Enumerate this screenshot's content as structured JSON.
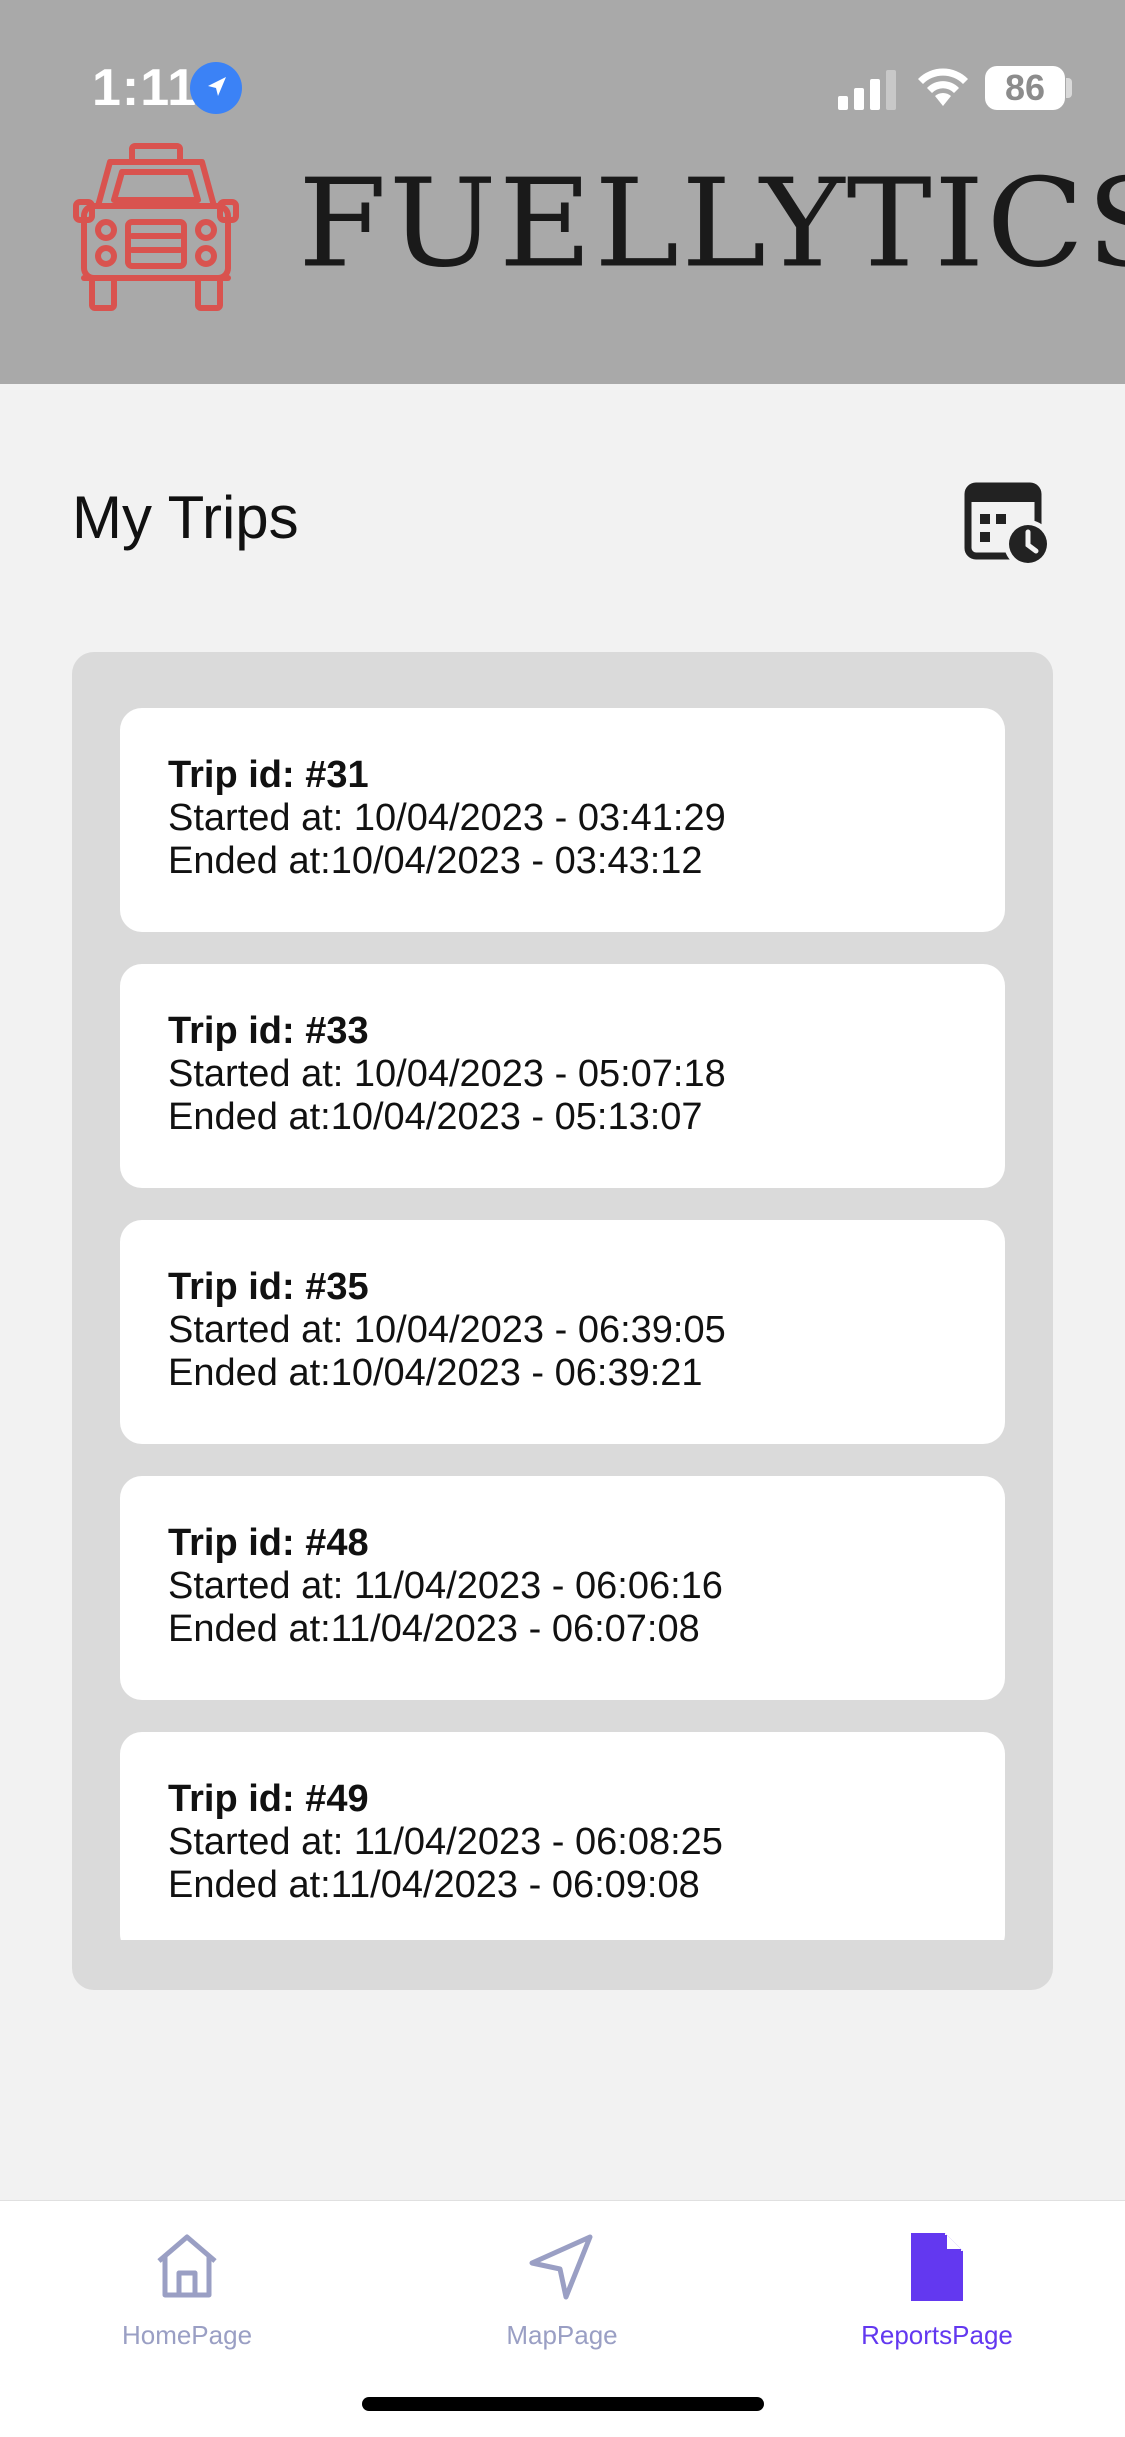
{
  "status_bar": {
    "time": "1:11",
    "battery": "86"
  },
  "app": {
    "brand": "FUELLYTICS",
    "logo_color": "#d9534f"
  },
  "page": {
    "title": "My Trips"
  },
  "trips": [
    {
      "id": "Trip id: #31",
      "started": "Started at: 10/04/2023 - 03:41:29",
      "ended": "Ended at:10/04/2023 - 03:43:12"
    },
    {
      "id": "Trip id: #33",
      "started": "Started at: 10/04/2023 - 05:07:18",
      "ended": "Ended at:10/04/2023 - 05:13:07"
    },
    {
      "id": "Trip id: #35",
      "started": "Started at: 10/04/2023 - 06:39:05",
      "ended": "Ended at:10/04/2023 - 06:39:21"
    },
    {
      "id": "Trip id: #48",
      "started": "Started at: 11/04/2023 - 06:06:16",
      "ended": "Ended at:11/04/2023 - 06:07:08"
    },
    {
      "id": "Trip id: #49",
      "started": "Started at: 11/04/2023 - 06:08:25",
      "ended": "Ended at:11/04/2023 - 06:09:08"
    }
  ],
  "nav": {
    "items": [
      {
        "label": "HomePage",
        "icon": "home-icon",
        "active": false
      },
      {
        "label": "MapPage",
        "icon": "navigation-arrow-icon",
        "active": false
      },
      {
        "label": "ReportsPage",
        "icon": "document-icon",
        "active": true
      }
    ],
    "active_color": "#6338f0",
    "inactive_color": "#9a9fc4"
  }
}
